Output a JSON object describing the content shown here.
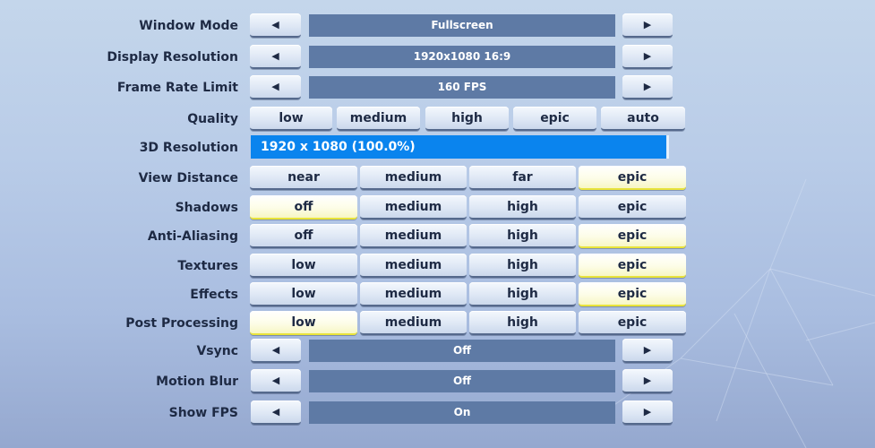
{
  "settings": {
    "window_mode": {
      "label": "Window Mode",
      "value": "Fullscreen",
      "prev": "◀",
      "next": "▶"
    },
    "display_resolution": {
      "label": "Display Resolution",
      "value": "1920x1080 16:9",
      "prev": "◀",
      "next": "▶"
    },
    "frame_rate_limit": {
      "label": "Frame Rate Limit",
      "value": "160 FPS",
      "prev": "◀",
      "next": "▶"
    },
    "quality": {
      "label": "Quality",
      "options": [
        "low",
        "medium",
        "high",
        "epic",
        "auto"
      ],
      "selected": null
    },
    "resolution_3d": {
      "label": "3D Resolution",
      "value": "1920 x 1080 (100.0%)",
      "percent": 100.0
    },
    "view_distance": {
      "label": "View Distance",
      "options": [
        "near",
        "medium",
        "far",
        "epic"
      ],
      "selected": "epic"
    },
    "shadows": {
      "label": "Shadows",
      "options": [
        "off",
        "medium",
        "high",
        "epic"
      ],
      "selected": "off"
    },
    "anti_aliasing": {
      "label": "Anti-Aliasing",
      "options": [
        "off",
        "medium",
        "high",
        "epic"
      ],
      "selected": "epic"
    },
    "textures": {
      "label": "Textures",
      "options": [
        "low",
        "medium",
        "high",
        "epic"
      ],
      "selected": "epic"
    },
    "effects": {
      "label": "Effects",
      "options": [
        "low",
        "medium",
        "high",
        "epic"
      ],
      "selected": "epic"
    },
    "post_processing": {
      "label": "Post Processing",
      "options": [
        "low",
        "medium",
        "high",
        "epic"
      ],
      "selected": "low"
    },
    "vsync": {
      "label": "Vsync",
      "value": "Off",
      "prev": "◀",
      "next": "▶"
    },
    "motion_blur": {
      "label": "Motion Blur",
      "value": "Off",
      "prev": "◀",
      "next": "▶"
    },
    "show_fps": {
      "label": "Show FPS",
      "value": "On",
      "prev": "◀",
      "next": "▶"
    }
  },
  "colors": {
    "selected_highlight": "#f7f6c4",
    "value_bar": "#5e7aa5",
    "resolution_bar": "#0a84ee",
    "label_text": "#1e2a44"
  }
}
